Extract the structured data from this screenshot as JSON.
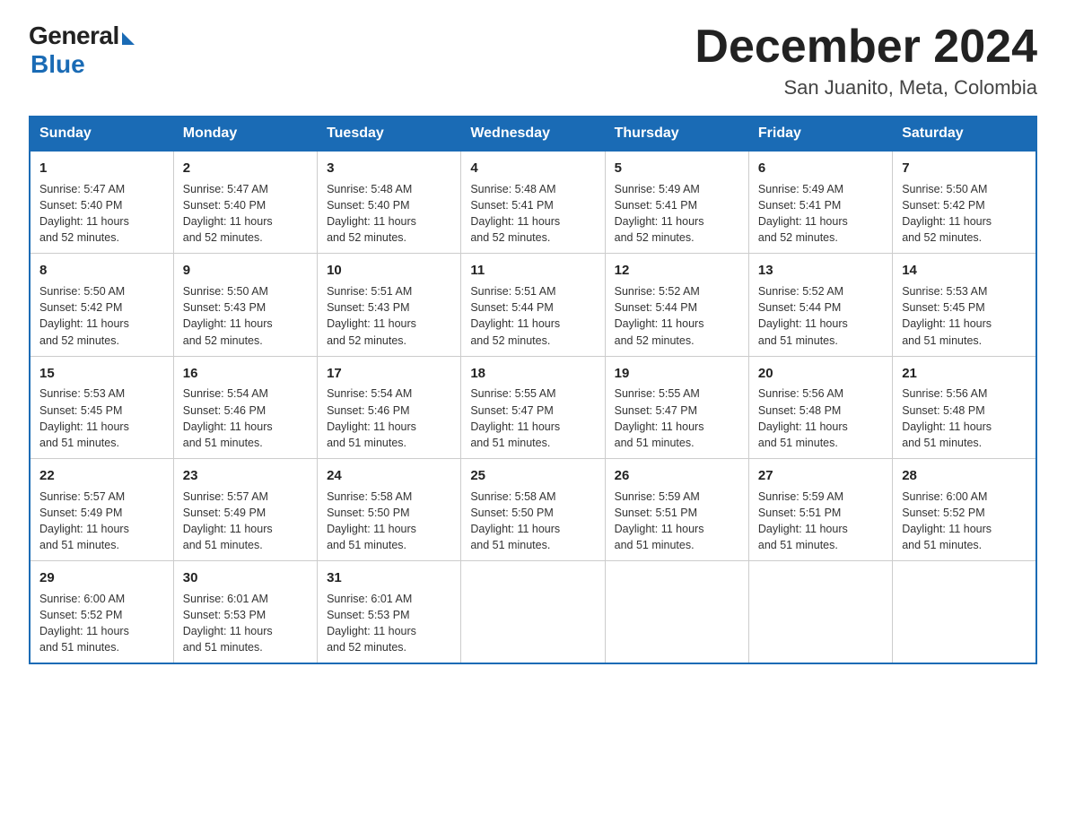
{
  "header": {
    "logo_general": "General",
    "logo_blue": "Blue",
    "title": "December 2024",
    "subtitle": "San Juanito, Meta, Colombia"
  },
  "days_of_week": [
    "Sunday",
    "Monday",
    "Tuesday",
    "Wednesday",
    "Thursday",
    "Friday",
    "Saturday"
  ],
  "weeks": [
    [
      {
        "day": "1",
        "sunrise": "5:47 AM",
        "sunset": "5:40 PM",
        "daylight": "11 hours and 52 minutes."
      },
      {
        "day": "2",
        "sunrise": "5:47 AM",
        "sunset": "5:40 PM",
        "daylight": "11 hours and 52 minutes."
      },
      {
        "day": "3",
        "sunrise": "5:48 AM",
        "sunset": "5:40 PM",
        "daylight": "11 hours and 52 minutes."
      },
      {
        "day": "4",
        "sunrise": "5:48 AM",
        "sunset": "5:41 PM",
        "daylight": "11 hours and 52 minutes."
      },
      {
        "day": "5",
        "sunrise": "5:49 AM",
        "sunset": "5:41 PM",
        "daylight": "11 hours and 52 minutes."
      },
      {
        "day": "6",
        "sunrise": "5:49 AM",
        "sunset": "5:41 PM",
        "daylight": "11 hours and 52 minutes."
      },
      {
        "day": "7",
        "sunrise": "5:50 AM",
        "sunset": "5:42 PM",
        "daylight": "11 hours and 52 minutes."
      }
    ],
    [
      {
        "day": "8",
        "sunrise": "5:50 AM",
        "sunset": "5:42 PM",
        "daylight": "11 hours and 52 minutes."
      },
      {
        "day": "9",
        "sunrise": "5:50 AM",
        "sunset": "5:43 PM",
        "daylight": "11 hours and 52 minutes."
      },
      {
        "day": "10",
        "sunrise": "5:51 AM",
        "sunset": "5:43 PM",
        "daylight": "11 hours and 52 minutes."
      },
      {
        "day": "11",
        "sunrise": "5:51 AM",
        "sunset": "5:44 PM",
        "daylight": "11 hours and 52 minutes."
      },
      {
        "day": "12",
        "sunrise": "5:52 AM",
        "sunset": "5:44 PM",
        "daylight": "11 hours and 52 minutes."
      },
      {
        "day": "13",
        "sunrise": "5:52 AM",
        "sunset": "5:44 PM",
        "daylight": "11 hours and 51 minutes."
      },
      {
        "day": "14",
        "sunrise": "5:53 AM",
        "sunset": "5:45 PM",
        "daylight": "11 hours and 51 minutes."
      }
    ],
    [
      {
        "day": "15",
        "sunrise": "5:53 AM",
        "sunset": "5:45 PM",
        "daylight": "11 hours and 51 minutes."
      },
      {
        "day": "16",
        "sunrise": "5:54 AM",
        "sunset": "5:46 PM",
        "daylight": "11 hours and 51 minutes."
      },
      {
        "day": "17",
        "sunrise": "5:54 AM",
        "sunset": "5:46 PM",
        "daylight": "11 hours and 51 minutes."
      },
      {
        "day": "18",
        "sunrise": "5:55 AM",
        "sunset": "5:47 PM",
        "daylight": "11 hours and 51 minutes."
      },
      {
        "day": "19",
        "sunrise": "5:55 AM",
        "sunset": "5:47 PM",
        "daylight": "11 hours and 51 minutes."
      },
      {
        "day": "20",
        "sunrise": "5:56 AM",
        "sunset": "5:48 PM",
        "daylight": "11 hours and 51 minutes."
      },
      {
        "day": "21",
        "sunrise": "5:56 AM",
        "sunset": "5:48 PM",
        "daylight": "11 hours and 51 minutes."
      }
    ],
    [
      {
        "day": "22",
        "sunrise": "5:57 AM",
        "sunset": "5:49 PM",
        "daylight": "11 hours and 51 minutes."
      },
      {
        "day": "23",
        "sunrise": "5:57 AM",
        "sunset": "5:49 PM",
        "daylight": "11 hours and 51 minutes."
      },
      {
        "day": "24",
        "sunrise": "5:58 AM",
        "sunset": "5:50 PM",
        "daylight": "11 hours and 51 minutes."
      },
      {
        "day": "25",
        "sunrise": "5:58 AM",
        "sunset": "5:50 PM",
        "daylight": "11 hours and 51 minutes."
      },
      {
        "day": "26",
        "sunrise": "5:59 AM",
        "sunset": "5:51 PM",
        "daylight": "11 hours and 51 minutes."
      },
      {
        "day": "27",
        "sunrise": "5:59 AM",
        "sunset": "5:51 PM",
        "daylight": "11 hours and 51 minutes."
      },
      {
        "day": "28",
        "sunrise": "6:00 AM",
        "sunset": "5:52 PM",
        "daylight": "11 hours and 51 minutes."
      }
    ],
    [
      {
        "day": "29",
        "sunrise": "6:00 AM",
        "sunset": "5:52 PM",
        "daylight": "11 hours and 51 minutes."
      },
      {
        "day": "30",
        "sunrise": "6:01 AM",
        "sunset": "5:53 PM",
        "daylight": "11 hours and 51 minutes."
      },
      {
        "day": "31",
        "sunrise": "6:01 AM",
        "sunset": "5:53 PM",
        "daylight": "11 hours and 52 minutes."
      },
      null,
      null,
      null,
      null
    ]
  ],
  "labels": {
    "sunrise": "Sunrise:",
    "sunset": "Sunset:",
    "daylight": "Daylight:"
  }
}
